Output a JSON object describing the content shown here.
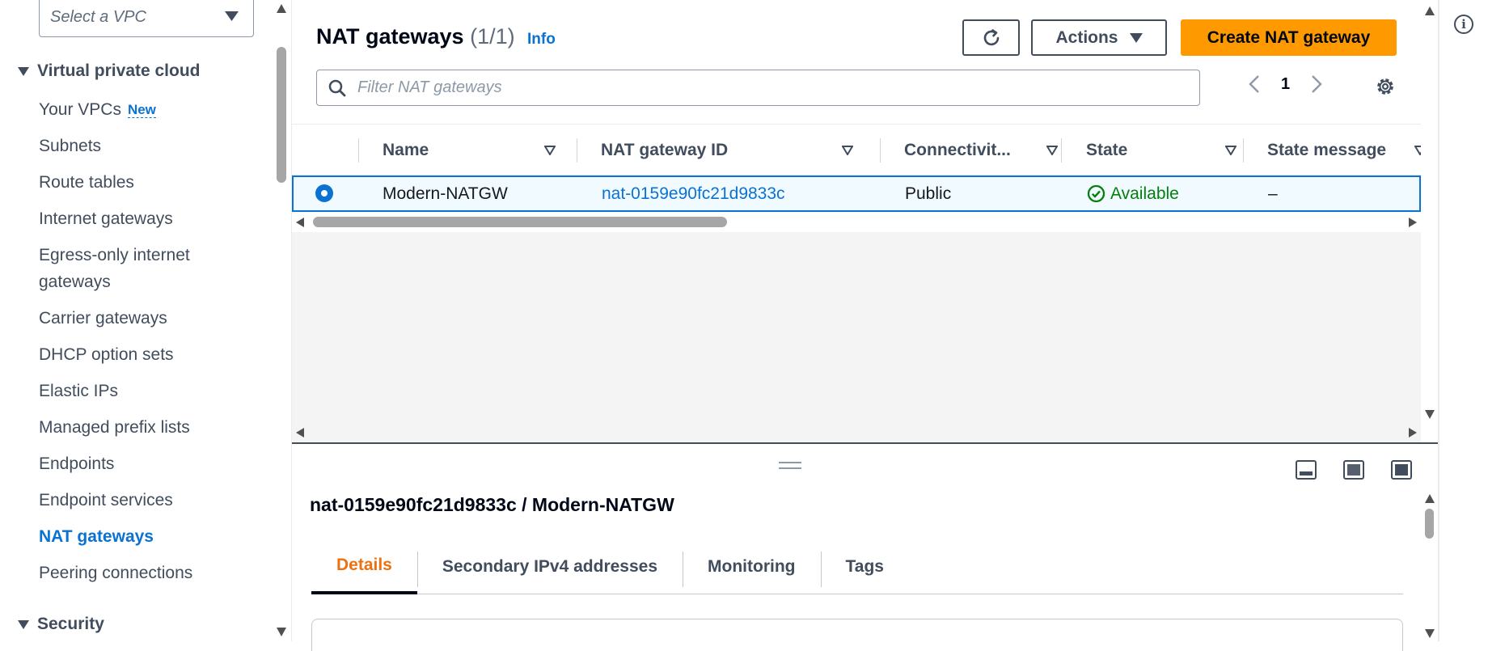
{
  "sidebar": {
    "vpc_select_placeholder": "Select a VPC",
    "section_vpc": "Virtual private cloud",
    "items": [
      {
        "label": "Your VPCs",
        "badge": "New"
      },
      {
        "label": "Subnets"
      },
      {
        "label": "Route tables"
      },
      {
        "label": "Internet gateways"
      },
      {
        "label": "Egress-only internet gateways"
      },
      {
        "label": "Carrier gateways"
      },
      {
        "label": "DHCP option sets"
      },
      {
        "label": "Elastic IPs"
      },
      {
        "label": "Managed prefix lists"
      },
      {
        "label": "Endpoints"
      },
      {
        "label": "Endpoint services"
      },
      {
        "label": "NAT gateways"
      },
      {
        "label": "Peering connections"
      }
    ],
    "section_security": "Security"
  },
  "header": {
    "title": "NAT gateways",
    "count": "(1/1)",
    "info": "Info",
    "actions_label": "Actions",
    "create_label": "Create NAT gateway"
  },
  "filter": {
    "placeholder": "Filter NAT gateways"
  },
  "pagination": {
    "current_page": "1"
  },
  "table": {
    "columns": [
      "Name",
      "NAT gateway ID",
      "Connectivit...",
      "State",
      "State message"
    ],
    "rows": [
      {
        "name": "Modern-NATGW",
        "id": "nat-0159e90fc21d9833c",
        "connectivity": "Public",
        "state": "Available",
        "state_message": "–"
      }
    ]
  },
  "detail_panel": {
    "title": "nat-0159e90fc21d9833c / Modern-NATGW",
    "tabs": [
      "Details",
      "Secondary IPv4 addresses",
      "Monitoring",
      "Tags"
    ],
    "active_tab": "Details"
  },
  "colors": {
    "accent": "#0972d3",
    "primary_button": "#ff9900",
    "active_tab": "#ec7211",
    "success": "#037f0c"
  },
  "icons": [
    "caret-down-icon",
    "refresh-icon",
    "search-icon",
    "chevron-left-icon",
    "chevron-right-icon",
    "gear-icon",
    "sort-icon",
    "check-circle-icon",
    "info-icon",
    "panel-bottom-icon",
    "panel-side-icon",
    "panel-full-icon"
  ]
}
